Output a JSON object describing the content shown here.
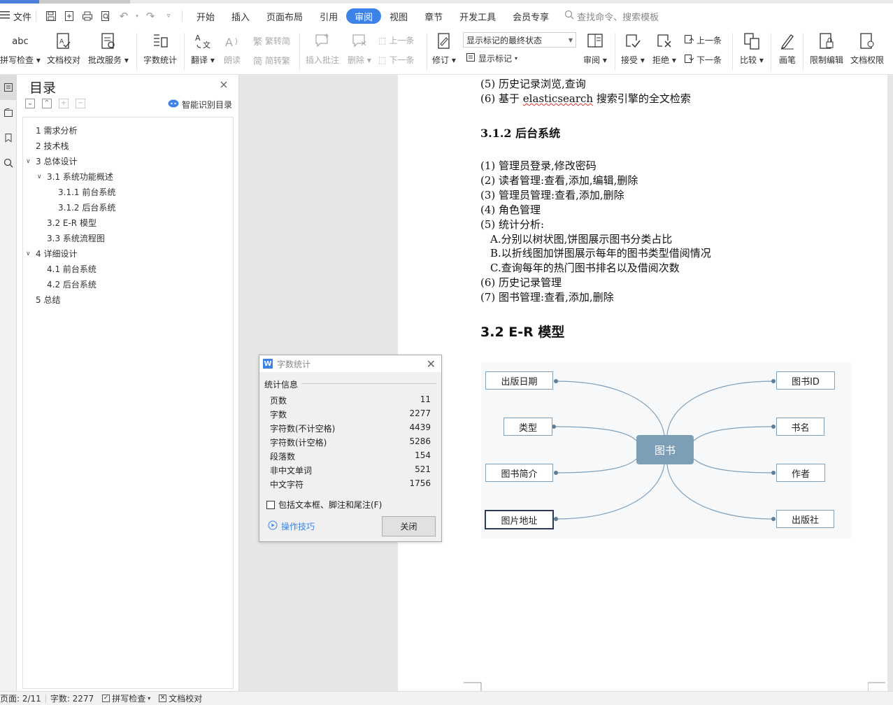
{
  "menubar": {
    "file_label": "文件",
    "tabs": [
      {
        "label": "开始"
      },
      {
        "label": "插入"
      },
      {
        "label": "页面布局"
      },
      {
        "label": "引用"
      },
      {
        "label": "审阅",
        "active": true
      },
      {
        "label": "视图"
      },
      {
        "label": "章节"
      },
      {
        "label": "开发工具"
      },
      {
        "label": "会员专享"
      }
    ],
    "search_placeholder": "查找命令、搜索模板"
  },
  "ribbon": {
    "spell_check": "拼写检查",
    "doc_proof": "文档校对",
    "revision_service": "批改服务",
    "word_count": "字数统计",
    "translate": "翻译",
    "read_aloud": "朗读",
    "to_traditional": "繁转简",
    "to_simplified": "简转繁",
    "insert_comment": "插入批注",
    "delete": "删除",
    "prev_comment": "上一条",
    "next_comment": "下一条",
    "track_changes": "修订",
    "markup_dropdown": "显示标记的最终状态",
    "show_markup": "显示标记",
    "review": "审阅",
    "accept": "接受",
    "reject": "拒绝",
    "prev_change": "上一条",
    "next_change": "下一条",
    "compare": "比较",
    "ink": "画笔",
    "restrict_edit": "限制编辑",
    "doc_permission": "文档权限"
  },
  "toc": {
    "title": "目录",
    "smart_label": "智能识别目录",
    "items": [
      {
        "label": "1  需求分析"
      },
      {
        "label": "2 技术栈"
      },
      {
        "label": "3  总体设计"
      },
      {
        "label": "3.1  系统功能概述"
      },
      {
        "label": "3.1.1  前台系统"
      },
      {
        "label": "3.1.2  后台系统"
      },
      {
        "label": "3.2 E-R 模型"
      },
      {
        "label": "3.3  系统流程图"
      },
      {
        "label": "4  详细设计"
      },
      {
        "label": "4.1  前台系统"
      },
      {
        "label": "4.2  后台系统"
      },
      {
        "label": "5  总结"
      }
    ]
  },
  "document": {
    "line_5": "(5)  历史记录浏览,查询",
    "line_6_prefix": "(6)  基于 ",
    "line_6_term": "elasticsearch",
    "line_6_suffix": " 搜索引擎的全文检索",
    "heading_312": "3.1.2  后台系统",
    "items": [
      "(1)  管理员登录,修改密码",
      "(2)  读者管理:查看,添加,编辑,删除",
      "(3)  管理员管理:查看,添加,删除",
      "(4)  角色管理",
      "(5)  统计分析:",
      "    A.分别以树状图,饼图展示图书分类占比",
      "    B.以折线图加饼图展示每年的图书类型借阅情况",
      "    C.查询每年的热门图书排名以及借阅次数",
      "(6)  历史记录管理",
      "(7)  图书管理:查看,添加,删除"
    ],
    "heading_32": "3.2 E-R 模型"
  },
  "mindmap": {
    "center": "图书",
    "left": [
      "出版日期",
      "类型",
      "图书简介",
      "图片地址"
    ],
    "right": [
      "图书ID",
      "书名",
      "作者",
      "出版社"
    ]
  },
  "dialog": {
    "title": "字数统计",
    "section": "统计信息",
    "rows": [
      {
        "label": "页数",
        "value": "11"
      },
      {
        "label": "字数",
        "value": "2277"
      },
      {
        "label": "字符数(不计空格)",
        "value": "4439"
      },
      {
        "label": "字符数(计空格)",
        "value": "5286"
      },
      {
        "label": "段落数",
        "value": "154"
      },
      {
        "label": "非中文单词",
        "value": "521"
      },
      {
        "label": "中文字符",
        "value": "1756"
      }
    ],
    "checkbox_label": "包括文本框、脚注和尾注(F)",
    "tips_label": "操作技巧",
    "close_label": "关闭"
  },
  "status": {
    "page": "页面: 2/11",
    "words": "字数: 2277",
    "spell": "拼写检查",
    "proof": "文档校对"
  }
}
